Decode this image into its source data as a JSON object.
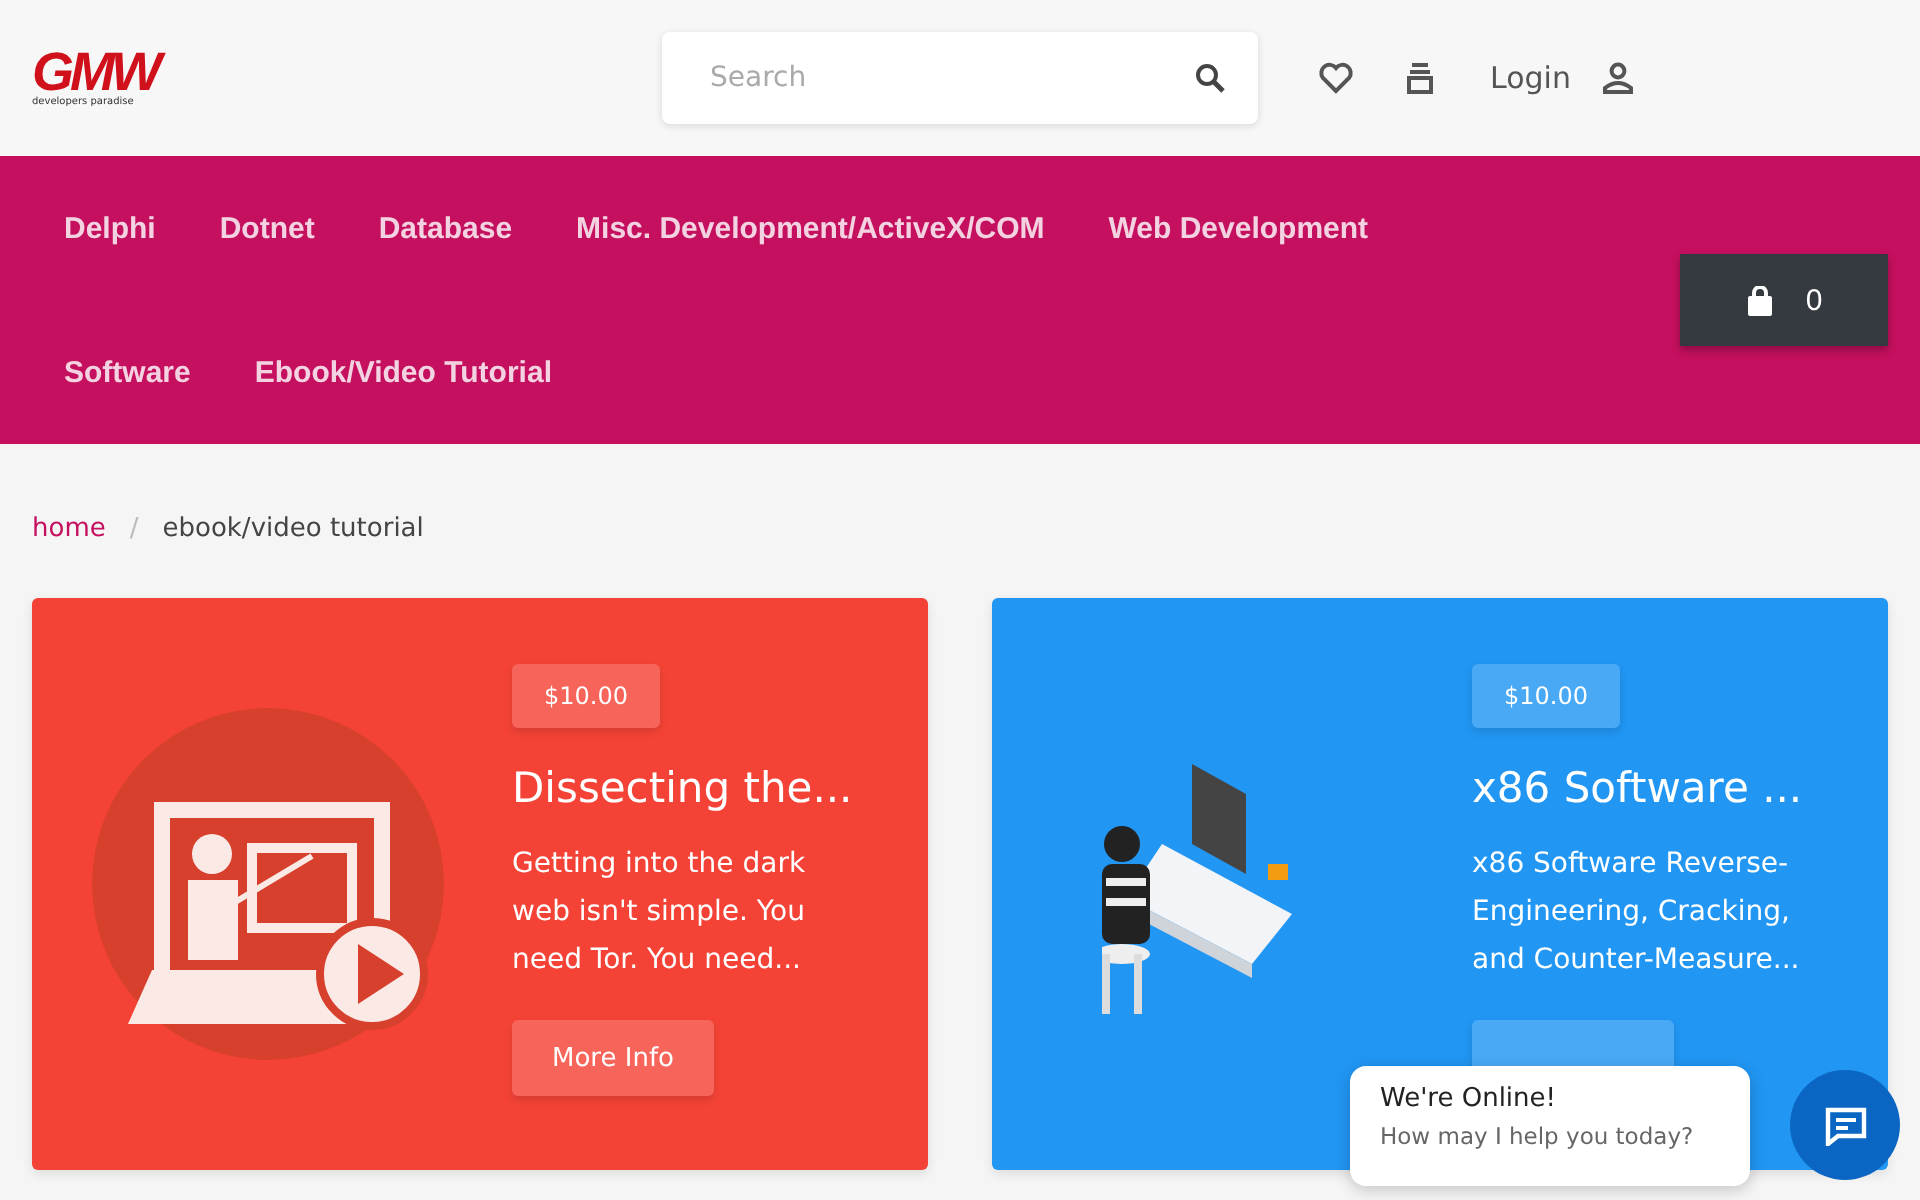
{
  "header": {
    "logo": {
      "mark": "GMW",
      "tagline": "developers paradise"
    },
    "search": {
      "placeholder": "Search"
    },
    "login": "Login"
  },
  "nav": {
    "items": [
      {
        "label": "Delphi"
      },
      {
        "label": "Dotnet"
      },
      {
        "label": "Database"
      },
      {
        "label": "Misc. Development/ActiveX/COM"
      },
      {
        "label": "Web Development"
      },
      {
        "label": "Software"
      },
      {
        "label": "Ebook/Video Tutorial"
      }
    ],
    "cart_count": "0"
  },
  "breadcrumb": {
    "separator": "/",
    "items": [
      {
        "label": "home",
        "kind": "link"
      },
      {
        "label": "ebook/video tutorial",
        "kind": "current"
      }
    ]
  },
  "cards": [
    {
      "kind": "presentation",
      "color": "#f44336",
      "price": "$10.00",
      "title": "Dissecting the...",
      "description": "Getting into the dark web isn't simple. You need Tor. You need...",
      "button": "More Info"
    },
    {
      "kind": "hacker",
      "color": "#2196f3",
      "price": "$10.00",
      "title": "x86 Software ...",
      "description": "x86 Software Reverse-Engineering, Cracking, and Counter-Measure..."
    }
  ],
  "chat": {
    "title": "We're Online!",
    "subtitle": "How may I help you today?"
  }
}
